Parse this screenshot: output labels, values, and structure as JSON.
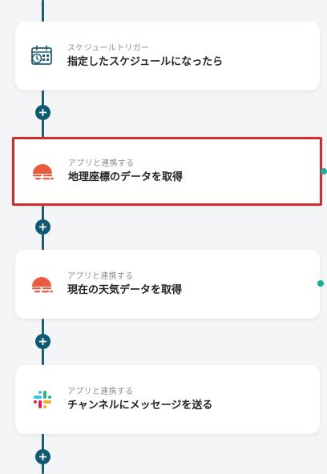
{
  "steps": [
    {
      "subtitle": "スケジュールトリガー",
      "title": "指定したスケジュールになったら",
      "icon": "schedule-calendar-icon"
    },
    {
      "subtitle": "アプリと連携する",
      "title": "地理座標のデータを取得",
      "icon": "openweather-sun-icon",
      "selected": true
    },
    {
      "subtitle": "アプリと連携する",
      "title": "現在の天気データを取得",
      "icon": "openweather-sun-icon"
    },
    {
      "subtitle": "アプリと連携する",
      "title": "チャンネルにメッセージを送る",
      "icon": "slack-icon"
    }
  ],
  "colors": {
    "connector": "#1f5f76",
    "add_button": "#0e5a74",
    "selected_border": "#d52b2b",
    "weather_icon": "#eb5a3c",
    "edge_dot": "#17b09a"
  }
}
